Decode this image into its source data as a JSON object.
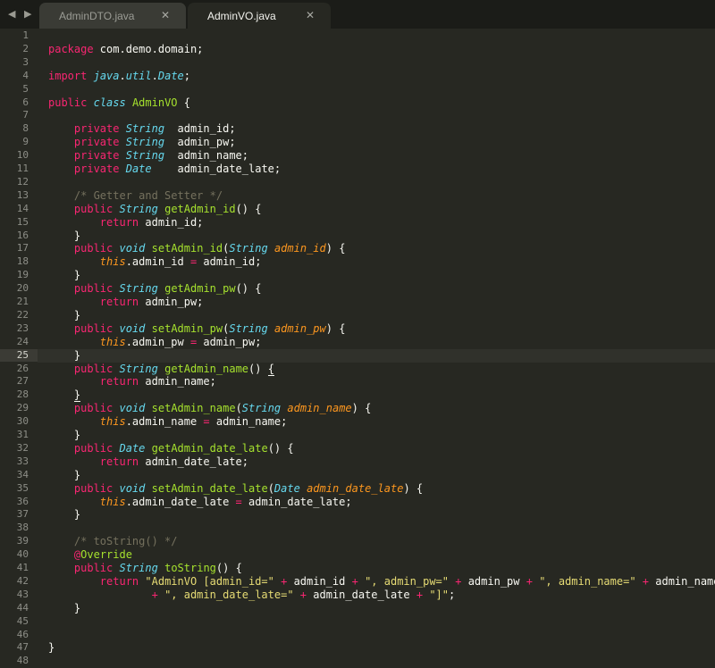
{
  "tabs": [
    {
      "label": "AdminDTO.java",
      "active": false
    },
    {
      "label": "AdminVO.java",
      "active": true
    }
  ],
  "nav": {
    "arrows": "◀ ▶"
  },
  "close_glyph": "✕",
  "current_line": 25,
  "code": [
    [],
    [
      [
        "kw",
        "package"
      ],
      [
        "t",
        " com.demo.domain;"
      ]
    ],
    [],
    [
      [
        "kw",
        "import"
      ],
      [
        "t",
        " "
      ],
      [
        "ty",
        "java"
      ],
      [
        "t",
        "."
      ],
      [
        "ty",
        "util"
      ],
      [
        "t",
        "."
      ],
      [
        "ty",
        "Date"
      ],
      [
        "t",
        ";"
      ]
    ],
    [],
    [
      [
        "kw",
        "public"
      ],
      [
        "t",
        " "
      ],
      [
        "ty",
        "class"
      ],
      [
        "t",
        " "
      ],
      [
        "fn",
        "AdminVO"
      ],
      [
        "t",
        " {"
      ]
    ],
    [],
    [
      [
        "t",
        "    "
      ],
      [
        "kw",
        "private"
      ],
      [
        "t",
        " "
      ],
      [
        "ty",
        "String"
      ],
      [
        "t",
        "  admin_id;"
      ]
    ],
    [
      [
        "t",
        "    "
      ],
      [
        "kw",
        "private"
      ],
      [
        "t",
        " "
      ],
      [
        "ty",
        "String"
      ],
      [
        "t",
        "  admin_pw;"
      ]
    ],
    [
      [
        "t",
        "    "
      ],
      [
        "kw",
        "private"
      ],
      [
        "t",
        " "
      ],
      [
        "ty",
        "String"
      ],
      [
        "t",
        "  admin_name;"
      ]
    ],
    [
      [
        "t",
        "    "
      ],
      [
        "kw",
        "private"
      ],
      [
        "t",
        " "
      ],
      [
        "ty",
        "Date"
      ],
      [
        "t",
        "    admin_date_late;"
      ]
    ],
    [],
    [
      [
        "t",
        "    "
      ],
      [
        "cm",
        "/* Getter and Setter */"
      ]
    ],
    [
      [
        "t",
        "    "
      ],
      [
        "kw",
        "public"
      ],
      [
        "t",
        " "
      ],
      [
        "ty",
        "String"
      ],
      [
        "t",
        " "
      ],
      [
        "fn",
        "getAdmin_id"
      ],
      [
        "t",
        "() {"
      ]
    ],
    [
      [
        "t",
        "        "
      ],
      [
        "kw",
        "return"
      ],
      [
        "t",
        " admin_id;"
      ]
    ],
    [
      [
        "t",
        "    }"
      ]
    ],
    [
      [
        "t",
        "    "
      ],
      [
        "kw",
        "public"
      ],
      [
        "t",
        " "
      ],
      [
        "ty",
        "void"
      ],
      [
        "t",
        " "
      ],
      [
        "fn",
        "setAdmin_id"
      ],
      [
        "t",
        "("
      ],
      [
        "ty",
        "String"
      ],
      [
        "t",
        " "
      ],
      [
        "pa",
        "admin_id"
      ],
      [
        "t",
        ") {"
      ]
    ],
    [
      [
        "t",
        "        "
      ],
      [
        "th",
        "this"
      ],
      [
        "t",
        ".admin_id "
      ],
      [
        "op",
        "="
      ],
      [
        "t",
        " admin_id;"
      ]
    ],
    [
      [
        "t",
        "    }"
      ]
    ],
    [
      [
        "t",
        "    "
      ],
      [
        "kw",
        "public"
      ],
      [
        "t",
        " "
      ],
      [
        "ty",
        "String"
      ],
      [
        "t",
        " "
      ],
      [
        "fn",
        "getAdmin_pw"
      ],
      [
        "t",
        "() {"
      ]
    ],
    [
      [
        "t",
        "        "
      ],
      [
        "kw",
        "return"
      ],
      [
        "t",
        " admin_pw;"
      ]
    ],
    [
      [
        "t",
        "    }"
      ]
    ],
    [
      [
        "t",
        "    "
      ],
      [
        "kw",
        "public"
      ],
      [
        "t",
        " "
      ],
      [
        "ty",
        "void"
      ],
      [
        "t",
        " "
      ],
      [
        "fn",
        "setAdmin_pw"
      ],
      [
        "t",
        "("
      ],
      [
        "ty",
        "String"
      ],
      [
        "t",
        " "
      ],
      [
        "pa",
        "admin_pw"
      ],
      [
        "t",
        ") {"
      ]
    ],
    [
      [
        "t",
        "        "
      ],
      [
        "th",
        "this"
      ],
      [
        "t",
        ".admin_pw "
      ],
      [
        "op",
        "="
      ],
      [
        "t",
        " admin_pw;"
      ]
    ],
    [
      [
        "t",
        "    }"
      ]
    ],
    [
      [
        "t",
        "    "
      ],
      [
        "kw",
        "public"
      ],
      [
        "t",
        " "
      ],
      [
        "ty",
        "String"
      ],
      [
        "t",
        " "
      ],
      [
        "fn",
        "getAdmin_name"
      ],
      [
        "t",
        "() "
      ],
      [
        "b",
        "{"
      ]
    ],
    [
      [
        "t",
        "        "
      ],
      [
        "kw",
        "return"
      ],
      [
        "t",
        " admin_name;"
      ]
    ],
    [
      [
        "t",
        "    "
      ],
      [
        "b",
        "}"
      ]
    ],
    [
      [
        "t",
        "    "
      ],
      [
        "kw",
        "public"
      ],
      [
        "t",
        " "
      ],
      [
        "ty",
        "void"
      ],
      [
        "t",
        " "
      ],
      [
        "fn",
        "setAdmin_name"
      ],
      [
        "t",
        "("
      ],
      [
        "ty",
        "String"
      ],
      [
        "t",
        " "
      ],
      [
        "pa",
        "admin_name"
      ],
      [
        "t",
        ") {"
      ]
    ],
    [
      [
        "t",
        "        "
      ],
      [
        "th",
        "this"
      ],
      [
        "t",
        ".admin_name "
      ],
      [
        "op",
        "="
      ],
      [
        "t",
        " admin_name;"
      ]
    ],
    [
      [
        "t",
        "    }"
      ]
    ],
    [
      [
        "t",
        "    "
      ],
      [
        "kw",
        "public"
      ],
      [
        "t",
        " "
      ],
      [
        "ty",
        "Date"
      ],
      [
        "t",
        " "
      ],
      [
        "fn",
        "getAdmin_date_late"
      ],
      [
        "t",
        "() {"
      ]
    ],
    [
      [
        "t",
        "        "
      ],
      [
        "kw",
        "return"
      ],
      [
        "t",
        " admin_date_late;"
      ]
    ],
    [
      [
        "t",
        "    }"
      ]
    ],
    [
      [
        "t",
        "    "
      ],
      [
        "kw",
        "public"
      ],
      [
        "t",
        " "
      ],
      [
        "ty",
        "void"
      ],
      [
        "t",
        " "
      ],
      [
        "fn",
        "setAdmin_date_late"
      ],
      [
        "t",
        "("
      ],
      [
        "ty",
        "Date"
      ],
      [
        "t",
        " "
      ],
      [
        "pa",
        "admin_date_late"
      ],
      [
        "t",
        ") {"
      ]
    ],
    [
      [
        "t",
        "        "
      ],
      [
        "th",
        "this"
      ],
      [
        "t",
        ".admin_date_late "
      ],
      [
        "op",
        "="
      ],
      [
        "t",
        " admin_date_late;"
      ]
    ],
    [
      [
        "t",
        "    }"
      ]
    ],
    [],
    [
      [
        "t",
        "    "
      ],
      [
        "cm",
        "/* toString() */"
      ]
    ],
    [
      [
        "t",
        "    "
      ],
      [
        "kw",
        "@"
      ],
      [
        "fn",
        "Override"
      ]
    ],
    [
      [
        "t",
        "    "
      ],
      [
        "kw",
        "public"
      ],
      [
        "t",
        " "
      ],
      [
        "ty",
        "String"
      ],
      [
        "t",
        " "
      ],
      [
        "fn",
        "toString"
      ],
      [
        "t",
        "() {"
      ]
    ],
    [
      [
        "t",
        "        "
      ],
      [
        "kw",
        "return"
      ],
      [
        "t",
        " "
      ],
      [
        "str",
        "\"AdminVO [admin_id=\""
      ],
      [
        "t",
        " "
      ],
      [
        "op",
        "+"
      ],
      [
        "t",
        " admin_id "
      ],
      [
        "op",
        "+"
      ],
      [
        "t",
        " "
      ],
      [
        "str",
        "\", admin_pw=\""
      ],
      [
        "t",
        " "
      ],
      [
        "op",
        "+"
      ],
      [
        "t",
        " admin_pw "
      ],
      [
        "op",
        "+"
      ],
      [
        "t",
        " "
      ],
      [
        "str",
        "\", admin_name=\""
      ],
      [
        "t",
        " "
      ],
      [
        "op",
        "+"
      ],
      [
        "t",
        " admin_name"
      ]
    ],
    [
      [
        "t",
        "                "
      ],
      [
        "op",
        "+"
      ],
      [
        "t",
        " "
      ],
      [
        "str",
        "\", admin_date_late=\""
      ],
      [
        "t",
        " "
      ],
      [
        "op",
        "+"
      ],
      [
        "t",
        " admin_date_late "
      ],
      [
        "op",
        "+"
      ],
      [
        "t",
        " "
      ],
      [
        "str",
        "\"]\""
      ],
      [
        "t",
        ";"
      ]
    ],
    [
      [
        "t",
        "    }"
      ]
    ],
    [],
    [],
    [
      [
        "t",
        "}"
      ]
    ],
    []
  ]
}
